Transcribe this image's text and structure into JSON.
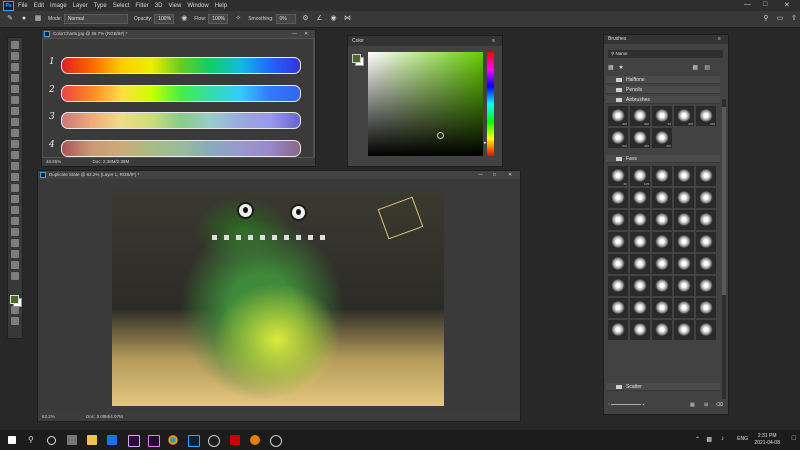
{
  "app": {
    "logo": "Ps",
    "menu": [
      "File",
      "Edit",
      "Image",
      "Layer",
      "Type",
      "Select",
      "Filter",
      "3D",
      "View",
      "Window",
      "Help"
    ]
  },
  "options": {
    "mode_label": "Mode:",
    "mode_value": "Normal",
    "opacity_label": "Opacity:",
    "opacity_value": "100%",
    "flow_label": "Flow:",
    "flow_value": "100%",
    "smoothing_label": "Smoothing:",
    "smoothing_value": "0%"
  },
  "chart_doc": {
    "title": "ColorCharts.jpg @ 46.7% (RGB/8#) *",
    "zoom": "46.65%",
    "doc": "Doc: 2.38M/2.38M",
    "rows": [
      "1",
      "2",
      "3",
      "4"
    ]
  },
  "color_panel": {
    "title": "Color"
  },
  "main_doc": {
    "title": "Duplicate State @ 62.2% (Layer 1, RGB/8*) *",
    "zoom": "62.2%",
    "doc": "Doc: 3.00M/4.07M"
  },
  "brushes": {
    "title": "Brushes",
    "search_label": "Name",
    "folders": {
      "halftone": "Halftone",
      "pencils": "Pencils",
      "airbrushes": "Airbrushes",
      "favs": "Favs",
      "scatter": "Scatter"
    },
    "airbrush_tips": [
      "400",
      "300",
      "50",
      "400",
      "250",
      "300",
      "400",
      "400"
    ],
    "fav_tips": [
      "60",
      "125",
      "",
      "",
      "",
      "",
      "",
      "",
      "",
      "",
      "",
      "",
      "",
      "",
      "",
      "",
      "",
      "",
      "",
      "",
      "",
      "",
      "",
      "",
      "",
      "",
      "",
      "",
      "",
      "",
      "",
      "",
      "",
      "",
      "",
      "",
      "",
      "",
      "",
      ""
    ]
  },
  "taskbar": {
    "lang": "ENG",
    "time": "2:31 PM",
    "date": "2021-04-08"
  },
  "colors": {
    "foreground": "#4b6b22",
    "background": "#ffffff",
    "accent": "#31a8ff"
  }
}
